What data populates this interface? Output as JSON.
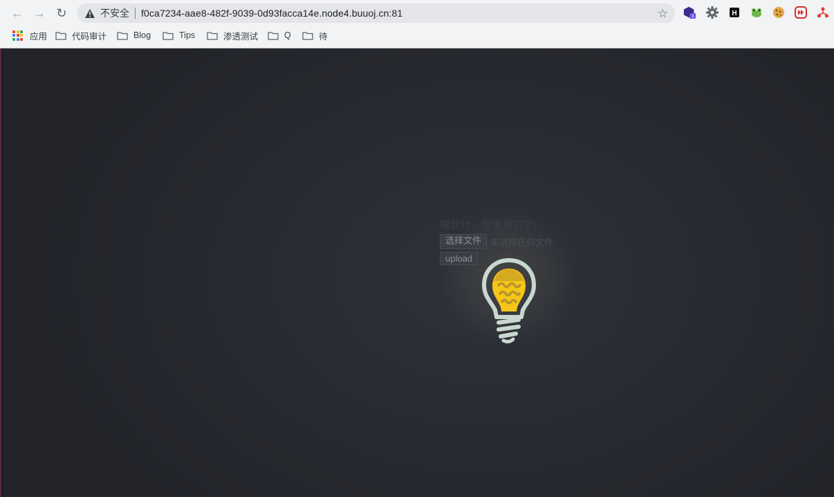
{
  "browser": {
    "security_label": "不安全",
    "url": "f0ca7234-aae8-482f-9039-0d93facca14e.node4.buuoj.cn:81",
    "extensions": [
      {
        "icon": "extension-hexagon-icon",
        "badge": "3",
        "color": "#4a2ca8"
      },
      {
        "icon": "extension-gear-icon",
        "color": "#5f6368"
      },
      {
        "icon": "extension-h-icon",
        "label": "H",
        "color": "#111111"
      },
      {
        "icon": "extension-frog-icon",
        "color": "#4caf50"
      },
      {
        "icon": "extension-cookie-icon",
        "color": "#e0a040"
      },
      {
        "icon": "extension-forward-icon",
        "color": "#d32f2f"
      },
      {
        "icon": "extension-network-icon",
        "color": "#e53935"
      }
    ]
  },
  "bookmarks": [
    {
      "label": "应用",
      "icon": "apps-grid-icon"
    },
    {
      "label": "代码审计",
      "icon": "folder-icon"
    },
    {
      "label": "Blog",
      "icon": "folder-icon"
    },
    {
      "label": "Tips",
      "icon": "folder-icon"
    },
    {
      "label": "渗透测试",
      "icon": "folder-icon"
    },
    {
      "label": "Q",
      "icon": "folder-icon"
    },
    {
      "label": "待",
      "icon": "folder-icon"
    }
  ],
  "page": {
    "title": "嘿伙计，你发现它了!",
    "choose_file_label": "选择文件",
    "file_status": "未选择任何文件",
    "upload_label": "upload",
    "bulb_icon": "lightbulb-icon",
    "colors": {
      "bulb_outline": "#c8d8d0",
      "bulb_fill": "#f5c518",
      "background": "#2a2c33"
    }
  }
}
